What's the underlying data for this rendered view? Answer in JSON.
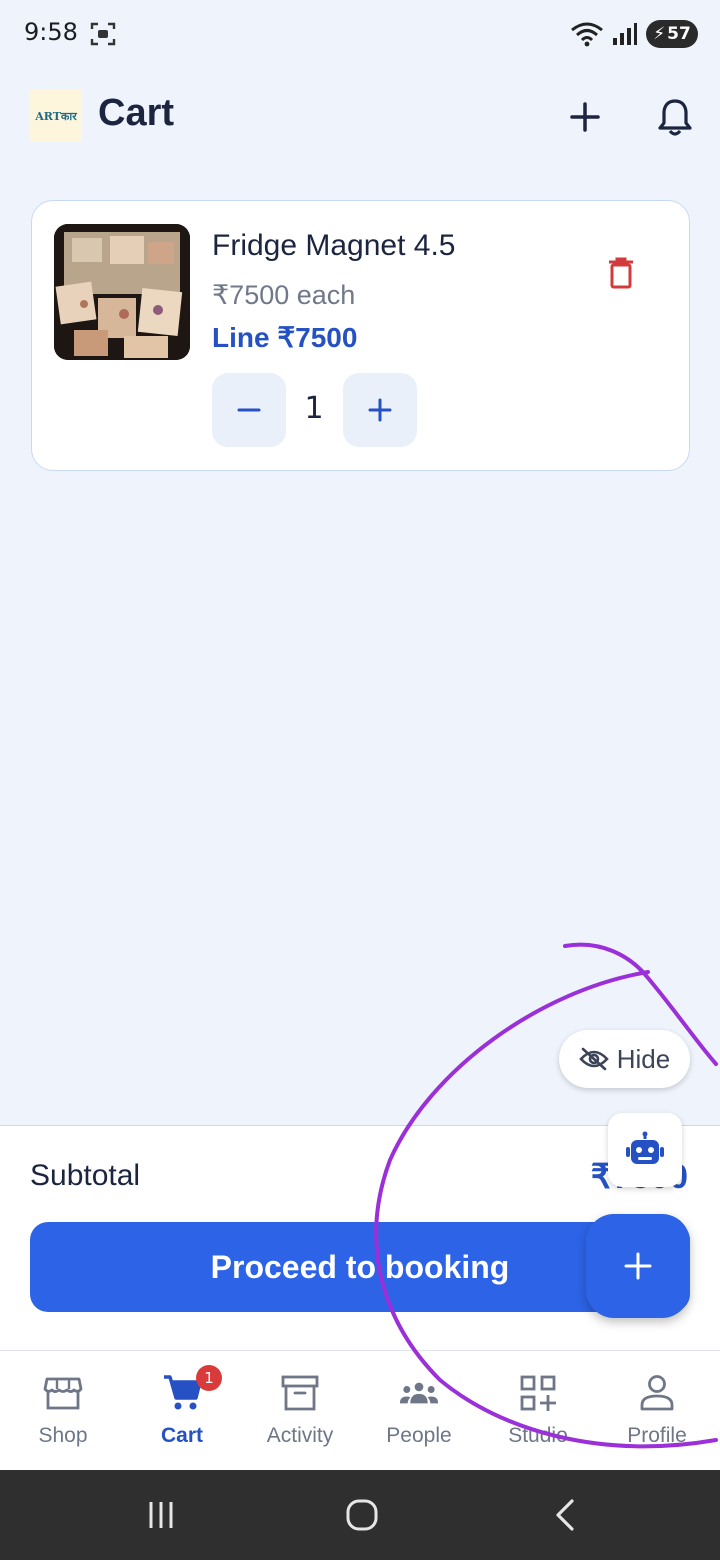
{
  "status_bar": {
    "time": "9:58",
    "battery": "57"
  },
  "header": {
    "title": "Cart",
    "logo_text": "ARTकार"
  },
  "cart": {
    "items": [
      {
        "name": "Fridge Magnet 4.5",
        "price": "₹7500 each",
        "line_total": "Line ₹7500",
        "quantity": "1"
      }
    ]
  },
  "floating": {
    "hide_label": "Hide"
  },
  "checkout": {
    "subtotal_label": "Subtotal",
    "subtotal_value": "₹7500",
    "proceed_label": "Proceed to booking"
  },
  "bottom_nav": {
    "items": [
      {
        "label": "Shop",
        "icon": "storefront-icon"
      },
      {
        "label": "Cart",
        "icon": "cart-icon",
        "badge": "1"
      },
      {
        "label": "Activity",
        "icon": "archive-icon"
      },
      {
        "label": "People",
        "icon": "people-icon"
      },
      {
        "label": "Studio",
        "icon": "grid-add-icon"
      },
      {
        "label": "Profile",
        "icon": "person-icon"
      }
    ],
    "active": "Cart"
  },
  "colors": {
    "accent": "#2d63e6",
    "link_blue": "#2551c4",
    "delete_red": "#d23b3b",
    "background": "#eef3fc",
    "annotation_purple": "#9b30d9"
  }
}
